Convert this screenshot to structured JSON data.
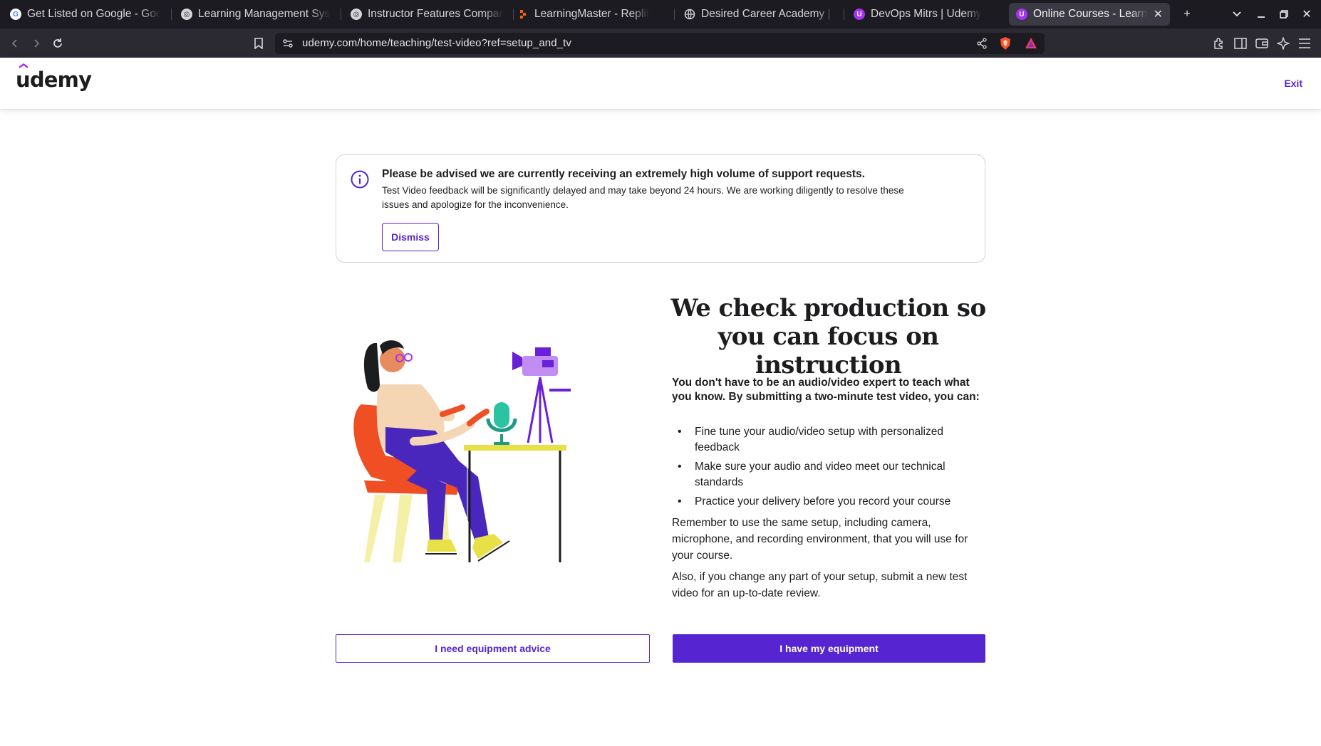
{
  "browser": {
    "tabs": [
      {
        "title": "Get Listed on Google - Goog",
        "icon": "google-icon"
      },
      {
        "title": "Learning Management Syst",
        "icon": "openai-icon"
      },
      {
        "title": "Instructor Features Compar",
        "icon": "openai-icon"
      },
      {
        "title": "LearningMaster - Replit",
        "icon": "replit-icon"
      },
      {
        "title": "Desired Career Academy | E",
        "icon": "globe-icon"
      },
      {
        "title": "DevOps Mitrs | Udemy",
        "icon": "udemy-icon"
      },
      {
        "title": "Online Courses - Learn A",
        "icon": "udemy-icon",
        "active": true
      }
    ],
    "url": "udemy.com/home/teaching/test-video?ref=setup_and_tv"
  },
  "header": {
    "logo_text": "udemy",
    "exit_label": "Exit"
  },
  "notice": {
    "title": "Please be advised we are currently receiving an extremely high volume of support requests.",
    "body": "Test Video feedback will be significantly delayed and may take beyond 24 hours. We are working diligently to resolve these issues and apologize for the inconvenience.",
    "dismiss_label": "Dismiss"
  },
  "main": {
    "headline": "We check production so you can focus on instruction",
    "intro": "You don't have to be an audio/video expert to teach what you know. By submitting a two-minute test video, you can:",
    "bullets": [
      "Fine tune your audio/video setup with personalized feedback",
      "Make sure your audio and video meet our technical standards",
      "Practice your delivery before you record your course"
    ],
    "paragraph1": "Remember to use the same setup, including camera, microphone, and recording environment, that you will use for your course.",
    "paragraph2": "Also, if you change any part of your setup, submit a new test video for an up-to-date review."
  },
  "actions": {
    "advice_label": "I need equipment advice",
    "have_equipment_label": "I have my equipment"
  },
  "colors": {
    "brand_purple": "#5624d0",
    "text": "#1c1d1f",
    "chrome_dark": "#1c1b22"
  }
}
